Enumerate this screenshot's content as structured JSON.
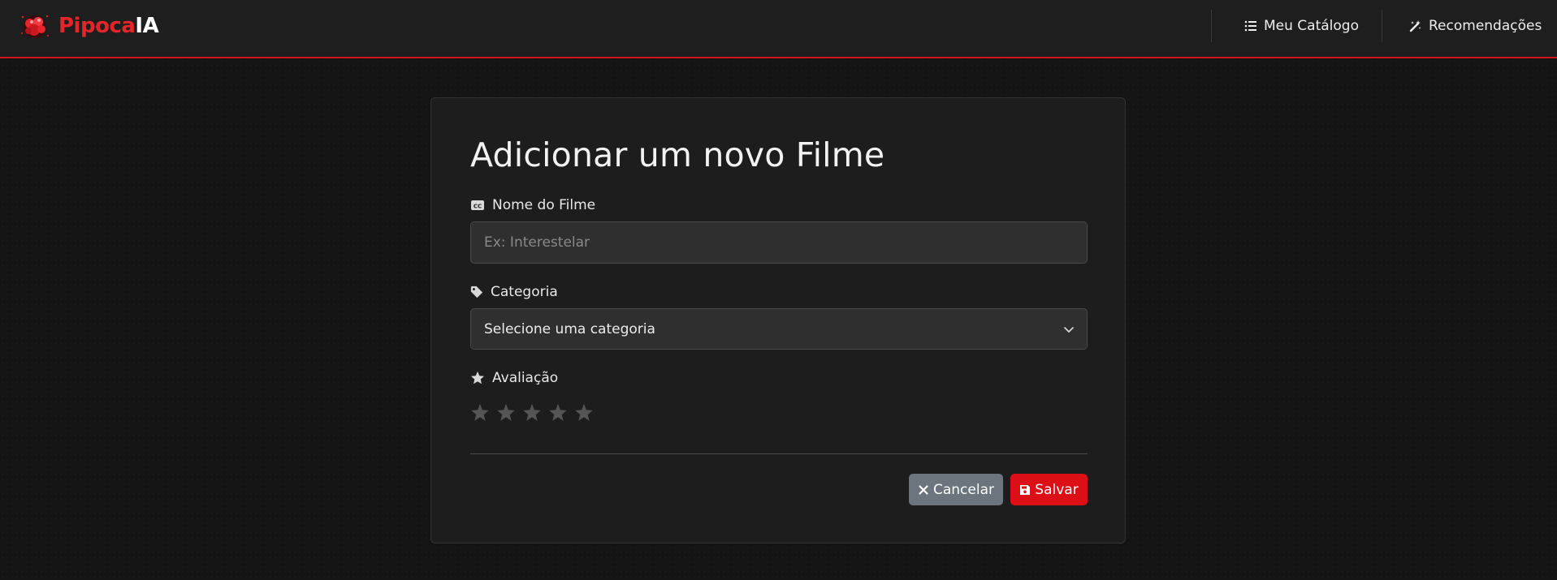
{
  "header": {
    "brand": {
      "part1": "Pipoca",
      "part2": "IA"
    },
    "nav": [
      {
        "label": "Meu Catálogo",
        "icon": "list-icon"
      },
      {
        "label": "Recomendações",
        "icon": "magic-wand-icon"
      }
    ]
  },
  "form": {
    "title": "Adicionar um novo Filme",
    "name_field": {
      "label": "Nome do Filme",
      "icon": "closed-captions-icon",
      "placeholder": "Ex: Interestelar",
      "value": ""
    },
    "category_field": {
      "label": "Categoria",
      "icon": "tag-icon",
      "selected": "Selecione uma categoria"
    },
    "rating_field": {
      "label": "Avaliação",
      "icon": "star-icon",
      "max": 5,
      "value": 0
    },
    "buttons": {
      "cancel": "Cancelar",
      "save": "Salvar"
    }
  },
  "colors": {
    "accent": "#dc0e16",
    "background": "#141414",
    "card": "#1d1d1d",
    "cancel": "#6c757d",
    "star_empty": "#555555"
  }
}
